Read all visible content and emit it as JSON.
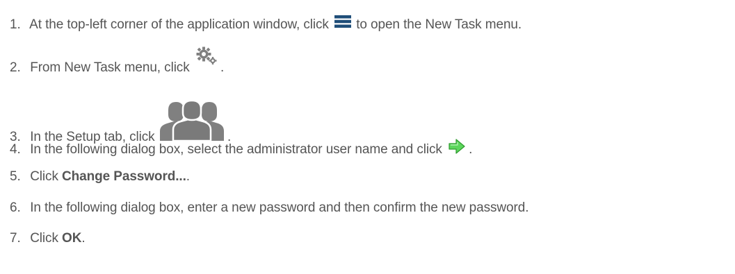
{
  "steps": [
    {
      "number": "1.",
      "before": "At the top-left corner of the application window, click",
      "icon": "hamburger-menu-icon",
      "after": "to open the New Task menu."
    },
    {
      "number": "2.",
      "before": "From New Task menu, click",
      "icon": "gears-settings-icon",
      "after": "."
    },
    {
      "number": "3.",
      "before": "In the Setup tab, click",
      "icon": "users-group-icon",
      "after": "."
    },
    {
      "number": "4.",
      "before": "In the following dialog box, select the administrator user name and click",
      "icon": "green-arrow-right-icon",
      "after": "."
    },
    {
      "number": "5.",
      "before": "Click",
      "bold": "Change Password...",
      "after": "."
    },
    {
      "number": "6.",
      "text": "In the following dialog box, enter a new password and then confirm the new password."
    },
    {
      "number": "7.",
      "before": "Click",
      "bold": "OK",
      "after": "."
    }
  ],
  "colors": {
    "text": "#555555",
    "menu_icon": "#1f4e79",
    "gear_icon": "#808080",
    "users_icon": "#808080",
    "arrow_green": "#5cd65c",
    "arrow_outline": "#2e9b2e"
  }
}
